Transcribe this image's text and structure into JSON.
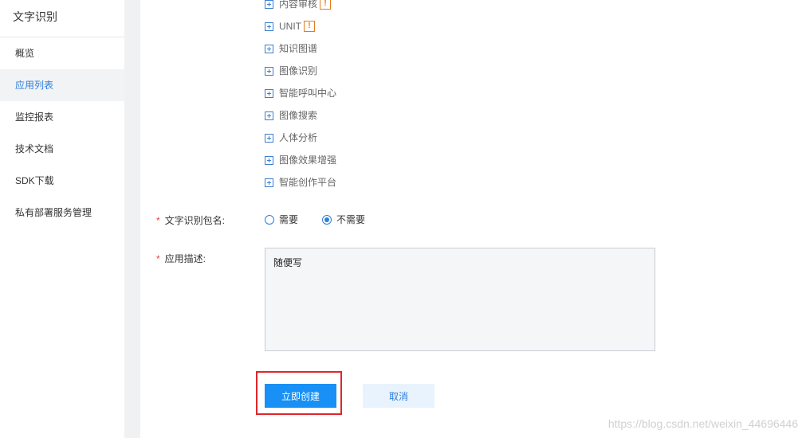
{
  "sidebar": {
    "title": "文字识别",
    "items": [
      {
        "label": "概览"
      },
      {
        "label": "应用列表"
      },
      {
        "label": "监控报表"
      },
      {
        "label": "技术文档"
      },
      {
        "label": "SDK下载"
      },
      {
        "label": "私有部署服务管理"
      }
    ],
    "active_index": 1
  },
  "tree": {
    "items": [
      {
        "label": "内容审核",
        "badge": "!"
      },
      {
        "label": "UNIT",
        "badge": "!"
      },
      {
        "label": "知识图谱"
      },
      {
        "label": "图像识别"
      },
      {
        "label": "智能呼叫中心"
      },
      {
        "label": "图像搜索"
      },
      {
        "label": "人体分析"
      },
      {
        "label": "图像效果增强"
      },
      {
        "label": "智能创作平台"
      }
    ]
  },
  "form": {
    "package_name": {
      "required_mark": "*",
      "label": "文字识别包名:",
      "options": [
        "需要",
        "不需要"
      ],
      "selected": "不需要"
    },
    "description": {
      "required_mark": "*",
      "label": "应用描述:",
      "value": "随便写"
    }
  },
  "actions": {
    "create_label": "立即创建",
    "cancel_label": "取消"
  },
  "watermark": "https://blog.csdn.net/weixin_44696446",
  "colors": {
    "accent": "#1890f5",
    "required": "#e64343",
    "warning": "#e37b1c",
    "highlight": "#e0262b"
  }
}
